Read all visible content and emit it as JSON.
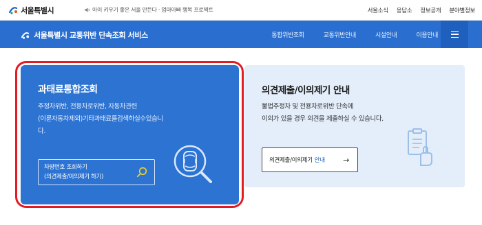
{
  "topbar": {
    "logo_text": "서울특별시",
    "campaign_text": "아이 키우기 좋은 서울 만든다 · 엄마아빠 행복 프로젝트",
    "links": [
      "서울소식",
      "응답소",
      "정보공개",
      "분야별정보"
    ]
  },
  "navbar": {
    "brand": "서울특별시 교통위반 단속조회 서비스",
    "items": [
      "통합위반조회",
      "교통위반안내",
      "시설안내",
      "이용안내"
    ]
  },
  "card1": {
    "title": "과태료통합조회",
    "desc_line1": "주정차위반, 전용차로위반, 자동차관련",
    "desc_line2": "(이륜자동차제외)기타과태료를검색하실수있습니",
    "desc_line3": "다.",
    "button_line1": "차량번호 조회하기",
    "button_line2": "(의견제출/이의제기 하기)"
  },
  "card2": {
    "title": "의견제출/이의제기 안내",
    "desc_line1": "불법주정차 및 전용차로위반 단속에",
    "desc_line2": "이의가 있을 경우 의견을 제출하실 수 있습니다.",
    "button_label": "의견제출/이의제기",
    "button_emph": "안내",
    "button_arrow": "→"
  },
  "colors": {
    "nav_blue": "#2a6fcf",
    "card_blue": "#2c73d2",
    "card_light": "#e4eefb",
    "highlight_red": "#e31b23",
    "search_yellow": "#f5d21c"
  }
}
